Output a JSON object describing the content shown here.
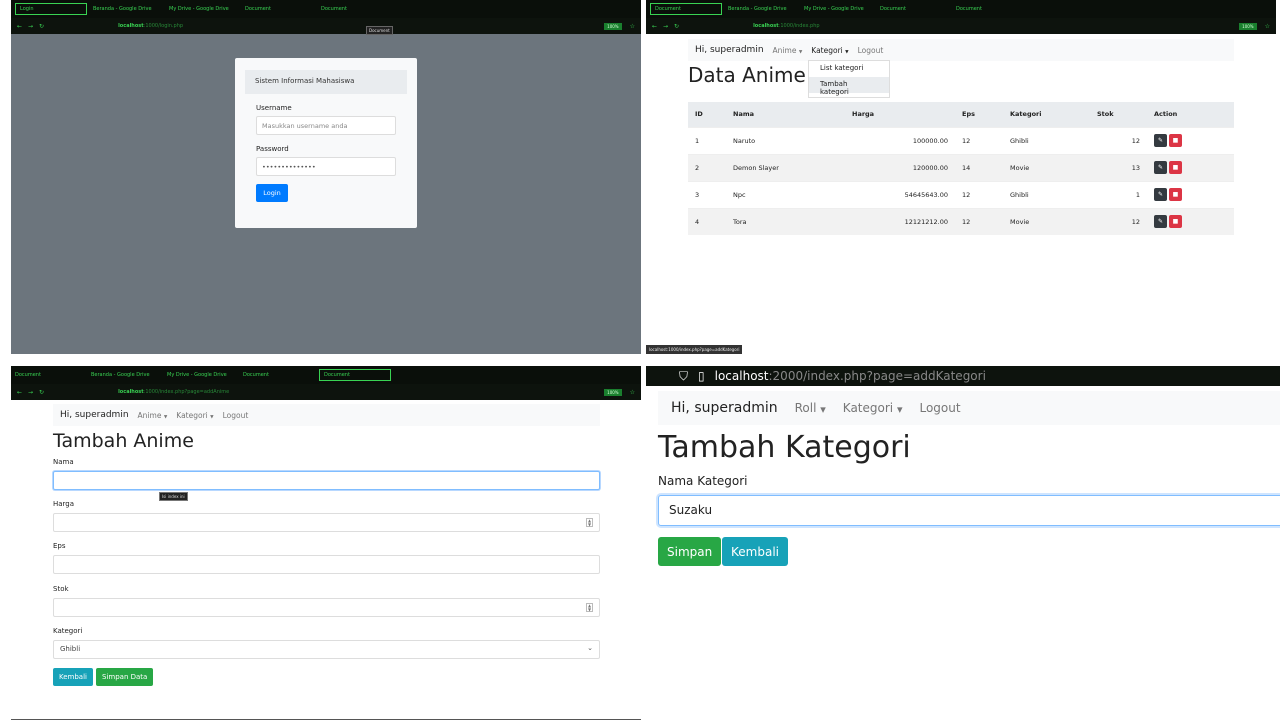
{
  "login_panel": {
    "tabs": [
      "Login",
      "Beranda - Google Drive",
      "My Drive - Google Drive",
      "Document",
      "Document"
    ],
    "url_host": "localhost",
    "url_rest": ":1000/login.php",
    "zoom": "100%",
    "tooltip": "Document",
    "card_title": "Sistem Informasi Mahasiswa",
    "username_label": "Username",
    "username_placeholder": "Masukkan username anda",
    "password_label": "Password",
    "password_value": "••••••••••••••",
    "login_button": "Login"
  },
  "list_panel": {
    "tabs": [
      "Document",
      "Beranda - Google Drive",
      "My Drive - Google Drive",
      "Document",
      "Document"
    ],
    "url_host": "localhost",
    "url_rest": ":1000/index.php",
    "zoom": "100%",
    "nav": {
      "greeting": "Hi, superadmin",
      "menu1": "Anime",
      "menu2": "Kategori",
      "logout": "Logout"
    },
    "dropdown": [
      "List kategori",
      "Tambah kategori"
    ],
    "title": "Data Anime",
    "columns": [
      "ID",
      "Nama",
      "Harga",
      "Eps",
      "Kategori",
      "Stok",
      "Action"
    ],
    "rows": [
      {
        "id": "1",
        "nama": "Naruto",
        "harga": "100000.00",
        "eps": "12",
        "kategori": "Ghibli",
        "stok": "12"
      },
      {
        "id": "2",
        "nama": "Demon Slayer",
        "harga": "120000.00",
        "eps": "14",
        "kategori": "Movie",
        "stok": "13"
      },
      {
        "id": "3",
        "nama": "Npc",
        "harga": "54645643.00",
        "eps": "12",
        "kategori": "Ghibli",
        "stok": "1"
      },
      {
        "id": "4",
        "nama": "Tora",
        "harga": "12121212.00",
        "eps": "12",
        "kategori": "Movie",
        "stok": "12"
      }
    ],
    "status_url": "localhost:1000/index.php?page=addKategori"
  },
  "add_anime_panel": {
    "tabs": [
      "Document",
      "Beranda - Google Drive",
      "My Drive - Google Drive",
      "Document",
      "Document"
    ],
    "url_host": "localhost",
    "url_rest": ":1000/index.php?page=addAnime",
    "zoom": "100%",
    "nav": {
      "greeting": "Hi, superadmin",
      "menu1": "Anime",
      "menu2": "Kategori",
      "logout": "Logout"
    },
    "title": "Tambah Anime",
    "labels": {
      "nama": "Nama",
      "harga": "Harga",
      "eps": "Eps",
      "stok": "Stok",
      "kategori": "Kategori"
    },
    "kategori_selected": "Ghibli",
    "tooltip": "Isi index ini",
    "btn_back": "Kembali",
    "btn_save": "Simpan Data"
  },
  "add_kategori_panel": {
    "url_host": "localhost",
    "url_rest": ":2000/index.php?page=addKategori",
    "nav": {
      "greeting": "Hi, superadmin",
      "menu1": "Roll",
      "menu2": "Kategori",
      "logout": "Logout"
    },
    "title": "Tambah Kategori",
    "label": "Nama Kategori",
    "input_value": "Suzaku",
    "btn_save": "Simpan",
    "btn_back": "Kembali"
  }
}
